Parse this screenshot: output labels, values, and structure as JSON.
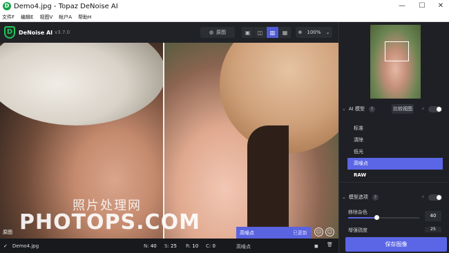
{
  "window": {
    "title": "Demo4.jpg - Topaz DeNoise AI",
    "logo_letter": "D",
    "minimize_glyph": "—",
    "maximize_glyph": "☐",
    "close_glyph": "✕"
  },
  "menu": [
    "文件F",
    "编辑E",
    "视图V",
    "帐户A",
    "帮助H"
  ],
  "brand": {
    "letter": "D",
    "name": "DeNoise AI",
    "version": "v3.7.0"
  },
  "toolbar": {
    "original_label": "原图",
    "original_icon": "◍",
    "view_icons": [
      "▣",
      "◫",
      "▥",
      "▦"
    ],
    "zoom_icon": "⊕",
    "zoom_level": "100%",
    "zoom_caret": "⌄"
  },
  "canvas": {
    "watermark_cn": "照片处理网",
    "watermark_en": "PHOTOPS.COM",
    "original_tag": "原图",
    "model_popup": {
      "name": "高噪点",
      "status": "已更新"
    },
    "face_icons": [
      "☹",
      "☺"
    ]
  },
  "bottom": {
    "check": "✓",
    "file_name": "Demo4.jpg",
    "stats": [
      {
        "label": "N:",
        "value": "40"
      },
      {
        "label": "S:",
        "value": "25"
      },
      {
        "label": "R:",
        "value": "10"
      },
      {
        "label": "C:",
        "value": "0"
      }
    ],
    "model_name": "高噪点",
    "camera_icon": "◼",
    "trash_icon": "🗑"
  },
  "panel": {
    "ai_model": {
      "chevron": "⌄",
      "title": "AI 模型",
      "help": "?",
      "compare_label": "比较视图",
      "bolt": "⚡",
      "items": [
        "标准",
        "清除",
        "低光",
        "高噪点",
        "RAW"
      ],
      "selected": 3
    },
    "model_options": {
      "chevron": "⌄",
      "title": "模型选项",
      "help": "?",
      "bolt": "⚡",
      "params": [
        {
          "label": "移除杂色",
          "value": "40",
          "level": 0.4
        },
        {
          "label": "增强锐度",
          "value": "25"
        }
      ]
    },
    "save_label": "保存图像"
  },
  "colors": {
    "accent": "#5b66e6",
    "brand_green": "#22c55e"
  }
}
